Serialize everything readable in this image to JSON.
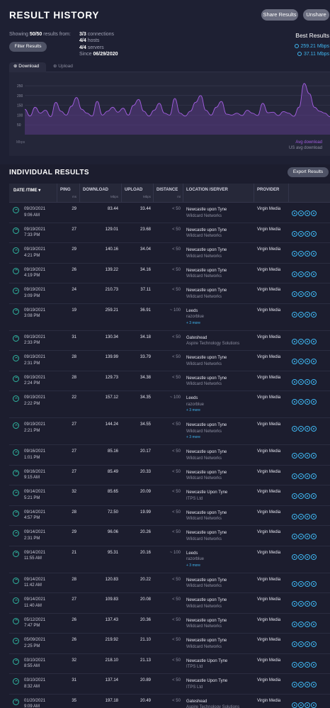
{
  "header": {
    "title": "RESULT HISTORY",
    "share_label": "Share Results",
    "unshare_label": "Unshare"
  },
  "summary": {
    "showing_prefix": "Showing",
    "showing_count": "50/50",
    "showing_suffix": "results from:",
    "connections_count": "3/3",
    "connections_label": "connections",
    "hosts_count": "4/4",
    "hosts_label": "hosts",
    "servers_count": "4/4",
    "servers_label": "servers",
    "since_label": "Since",
    "since_date": "06/29/2020",
    "filter_label": "Filter Results"
  },
  "best": {
    "title": "Best Results",
    "download": "259.21 Mbps",
    "upload": "37.11 Mbps"
  },
  "tabs": [
    {
      "label": "Download",
      "active": true
    },
    {
      "label": "Upload",
      "active": false
    }
  ],
  "chart_data": {
    "type": "area",
    "ylabel": "Mbps",
    "y_ticks": [
      "250",
      "200",
      "150",
      "100",
      "50"
    ],
    "ylim": [
      0,
      290
    ],
    "series": [
      {
        "name": "Avg download",
        "color": "#a25ee0",
        "values": [
          130,
          95,
          140,
          110,
          125,
          92,
          165,
          120,
          100,
          145,
          190,
          130,
          110,
          95,
          170,
          100,
          120,
          140,
          115,
          135,
          100,
          150,
          180,
          120,
          95,
          125,
          160,
          110,
          100,
          185,
          110,
          95,
          120,
          165,
          200,
          125,
          100,
          140,
          170,
          105,
          100,
          110,
          98,
          125,
          110,
          98,
          160,
          112,
          115,
          98,
          118,
          110,
          94,
          140,
          262,
          210,
          140,
          120,
          110,
          92
        ]
      }
    ],
    "us_avg_label": "US avg download",
    "grid": true,
    "legend_position": "bottom-right"
  },
  "chart_legend": {
    "avg_download": "Avg download",
    "us_avg": "US avg download"
  },
  "individual": {
    "title": "INDIVIDUAL RESULTS",
    "export_label": "Export Results"
  },
  "columns": {
    "date": "DATE /TIME",
    "ping": "PING",
    "ping_unit": "ms",
    "download": "DOWNLOAD",
    "download_unit": "Mbps",
    "upload": "UPLOAD",
    "upload_unit": "Mbps",
    "distance": "DISTANCE",
    "distance_unit": "mi",
    "location": "LOCATION /SERVER",
    "provider": "PROVIDER"
  },
  "rows": [
    {
      "date": "09/20/2021",
      "time": "9:06 AM",
      "ping": "29",
      "download": "83.44",
      "upload": "33.44",
      "distance": "< 50",
      "location": "Newcastle upon Tyne",
      "server": "Wildcard Networks",
      "more": "",
      "provider": "Virgin Media"
    },
    {
      "date": "09/19/2021",
      "time": "7:33 PM",
      "ping": "27",
      "download": "129.01",
      "upload": "23.68",
      "distance": "< 50",
      "location": "Newcastle upon Tyne",
      "server": "Wildcard Networks",
      "more": "",
      "provider": "Virgin Media"
    },
    {
      "date": "09/19/2021",
      "time": "4:21 PM",
      "ping": "29",
      "download": "140.16",
      "upload": "34.04",
      "distance": "< 50",
      "location": "Newcastle upon Tyne",
      "server": "Wildcard Networks",
      "more": "",
      "provider": "Virgin Media"
    },
    {
      "date": "09/19/2021",
      "time": "4:19 PM",
      "ping": "26",
      "download": "139.22",
      "upload": "34.16",
      "distance": "< 50",
      "location": "Newcastle upon Tyne",
      "server": "Wildcard Networks",
      "more": "",
      "provider": "Virgin Media"
    },
    {
      "date": "09/19/2021",
      "time": "3:09 PM",
      "ping": "24",
      "download": "210.73",
      "upload": "37.11",
      "distance": "< 50",
      "location": "Newcastle upon Tyne",
      "server": "Wildcard Networks",
      "more": "",
      "provider": "Virgin Media"
    },
    {
      "date": "09/19/2021",
      "time": "3:08 PM",
      "ping": "19",
      "download": "259.21",
      "upload": "36.91",
      "distance": "~ 100",
      "location": "Leeds",
      "server": "razorblue",
      "more": "+ 3 more",
      "provider": "Virgin Media"
    },
    {
      "date": "09/19/2021",
      "time": "2:33 PM",
      "ping": "31",
      "download": "130.34",
      "upload": "34.18",
      "distance": "< 50",
      "location": "Gateshead",
      "server": "Aspire Technology Solutions",
      "more": "",
      "provider": "Virgin Media"
    },
    {
      "date": "09/19/2021",
      "time": "2:31 PM",
      "ping": "28",
      "download": "139.99",
      "upload": "33.79",
      "distance": "< 50",
      "location": "Newcastle upon Tyne",
      "server": "Wildcard Networks",
      "more": "",
      "provider": "Virgin Media"
    },
    {
      "date": "09/19/2021",
      "time": "2:24 PM",
      "ping": "28",
      "download": "129.73",
      "upload": "34.38",
      "distance": "< 50",
      "location": "Newcastle upon Tyne",
      "server": "Wildcard Networks",
      "more": "",
      "provider": "Virgin Media"
    },
    {
      "date": "09/19/2021",
      "time": "2:22 PM",
      "ping": "22",
      "download": "157.12",
      "upload": "34.35",
      "distance": "~ 100",
      "location": "Leeds",
      "server": "razorblue",
      "more": "+ 3 more",
      "provider": "Virgin Media"
    },
    {
      "date": "09/19/2021",
      "time": "2:21 PM",
      "ping": "27",
      "download": "144.24",
      "upload": "34.55",
      "distance": "< 50",
      "location": "Newcastle upon Tyne",
      "server": "Wildcard Networks",
      "more": "+ 3 more",
      "provider": "Virgin Media"
    },
    {
      "date": "09/16/2021",
      "time": "1:01 PM",
      "ping": "27",
      "download": "85.16",
      "upload": "20.17",
      "distance": "< 50",
      "location": "Newcastle upon Tyne",
      "server": "Wildcard Networks",
      "more": "",
      "provider": "Virgin Media"
    },
    {
      "date": "09/16/2021",
      "time": "9:15 AM",
      "ping": "27",
      "download": "85.49",
      "upload": "20.33",
      "distance": "< 50",
      "location": "Newcastle upon Tyne",
      "server": "Wildcard Networks",
      "more": "",
      "provider": "Virgin Media"
    },
    {
      "date": "09/14/2021",
      "time": "5:21 PM",
      "ping": "32",
      "download": "85.65",
      "upload": "20.09",
      "distance": "< 50",
      "location": "Newcastle Upon Tyne",
      "server": "ITPS Ltd",
      "more": "",
      "provider": "Virgin Media"
    },
    {
      "date": "09/14/2021",
      "time": "4:57 PM",
      "ping": "28",
      "download": "72.50",
      "upload": "19.99",
      "distance": "< 50",
      "location": "Newcastle upon Tyne",
      "server": "Wildcard Networks",
      "more": "",
      "provider": "Virgin Media"
    },
    {
      "date": "09/14/2021",
      "time": "2:31 PM",
      "ping": "29",
      "download": "96.06",
      "upload": "20.26",
      "distance": "< 50",
      "location": "Newcastle upon Tyne",
      "server": "Wildcard Networks",
      "more": "",
      "provider": "Virgin Media"
    },
    {
      "date": "09/14/2021",
      "time": "11:55 AM",
      "ping": "21",
      "download": "95.31",
      "upload": "20.16",
      "distance": "~ 100",
      "location": "Leeds",
      "server": "razorblue",
      "more": "+ 3 more",
      "provider": "Virgin Media"
    },
    {
      "date": "09/14/2021",
      "time": "11:42 AM",
      "ping": "28",
      "download": "120.83",
      "upload": "20.22",
      "distance": "< 50",
      "location": "Newcastle upon Tyne",
      "server": "Wildcard Networks",
      "more": "",
      "provider": "Virgin Media"
    },
    {
      "date": "09/14/2021",
      "time": "11:40 AM",
      "ping": "27",
      "download": "109.83",
      "upload": "20.08",
      "distance": "< 50",
      "location": "Newcastle upon Tyne",
      "server": "Wildcard Networks",
      "more": "",
      "provider": "Virgin Media"
    },
    {
      "date": "05/12/2021",
      "time": "7:47 PM",
      "ping": "26",
      "download": "137.43",
      "upload": "20.36",
      "distance": "< 50",
      "location": "Newcastle upon Tyne",
      "server": "Wildcard Networks",
      "more": "",
      "provider": "Virgin Media"
    },
    {
      "date": "05/09/2021",
      "time": "2:25 PM",
      "ping": "26",
      "download": "219.92",
      "upload": "21.10",
      "distance": "< 50",
      "location": "Newcastle upon Tyne",
      "server": "Wildcard Networks",
      "more": "",
      "provider": "Virgin Media"
    },
    {
      "date": "03/10/2021",
      "time": "8:55 AM",
      "ping": "32",
      "download": "218.10",
      "upload": "21.13",
      "distance": "< 50",
      "location": "Newcastle Upon Tyne",
      "server": "ITPS Ltd",
      "more": "",
      "provider": "Virgin Media"
    },
    {
      "date": "03/10/2021",
      "time": "8:32 AM",
      "ping": "31",
      "download": "137.14",
      "upload": "20.89",
      "distance": "< 50",
      "location": "Newcastle Upon Tyne",
      "server": "ITPS Ltd",
      "more": "",
      "provider": "Virgin Media"
    },
    {
      "date": "01/20/2021",
      "time": "9:09 AM",
      "ping": "35",
      "download": "197.18",
      "upload": "20.49",
      "distance": "< 50",
      "location": "Gateshead",
      "server": "Aspire Technology Solutions",
      "more": "",
      "provider": "Virgin Media"
    }
  ]
}
